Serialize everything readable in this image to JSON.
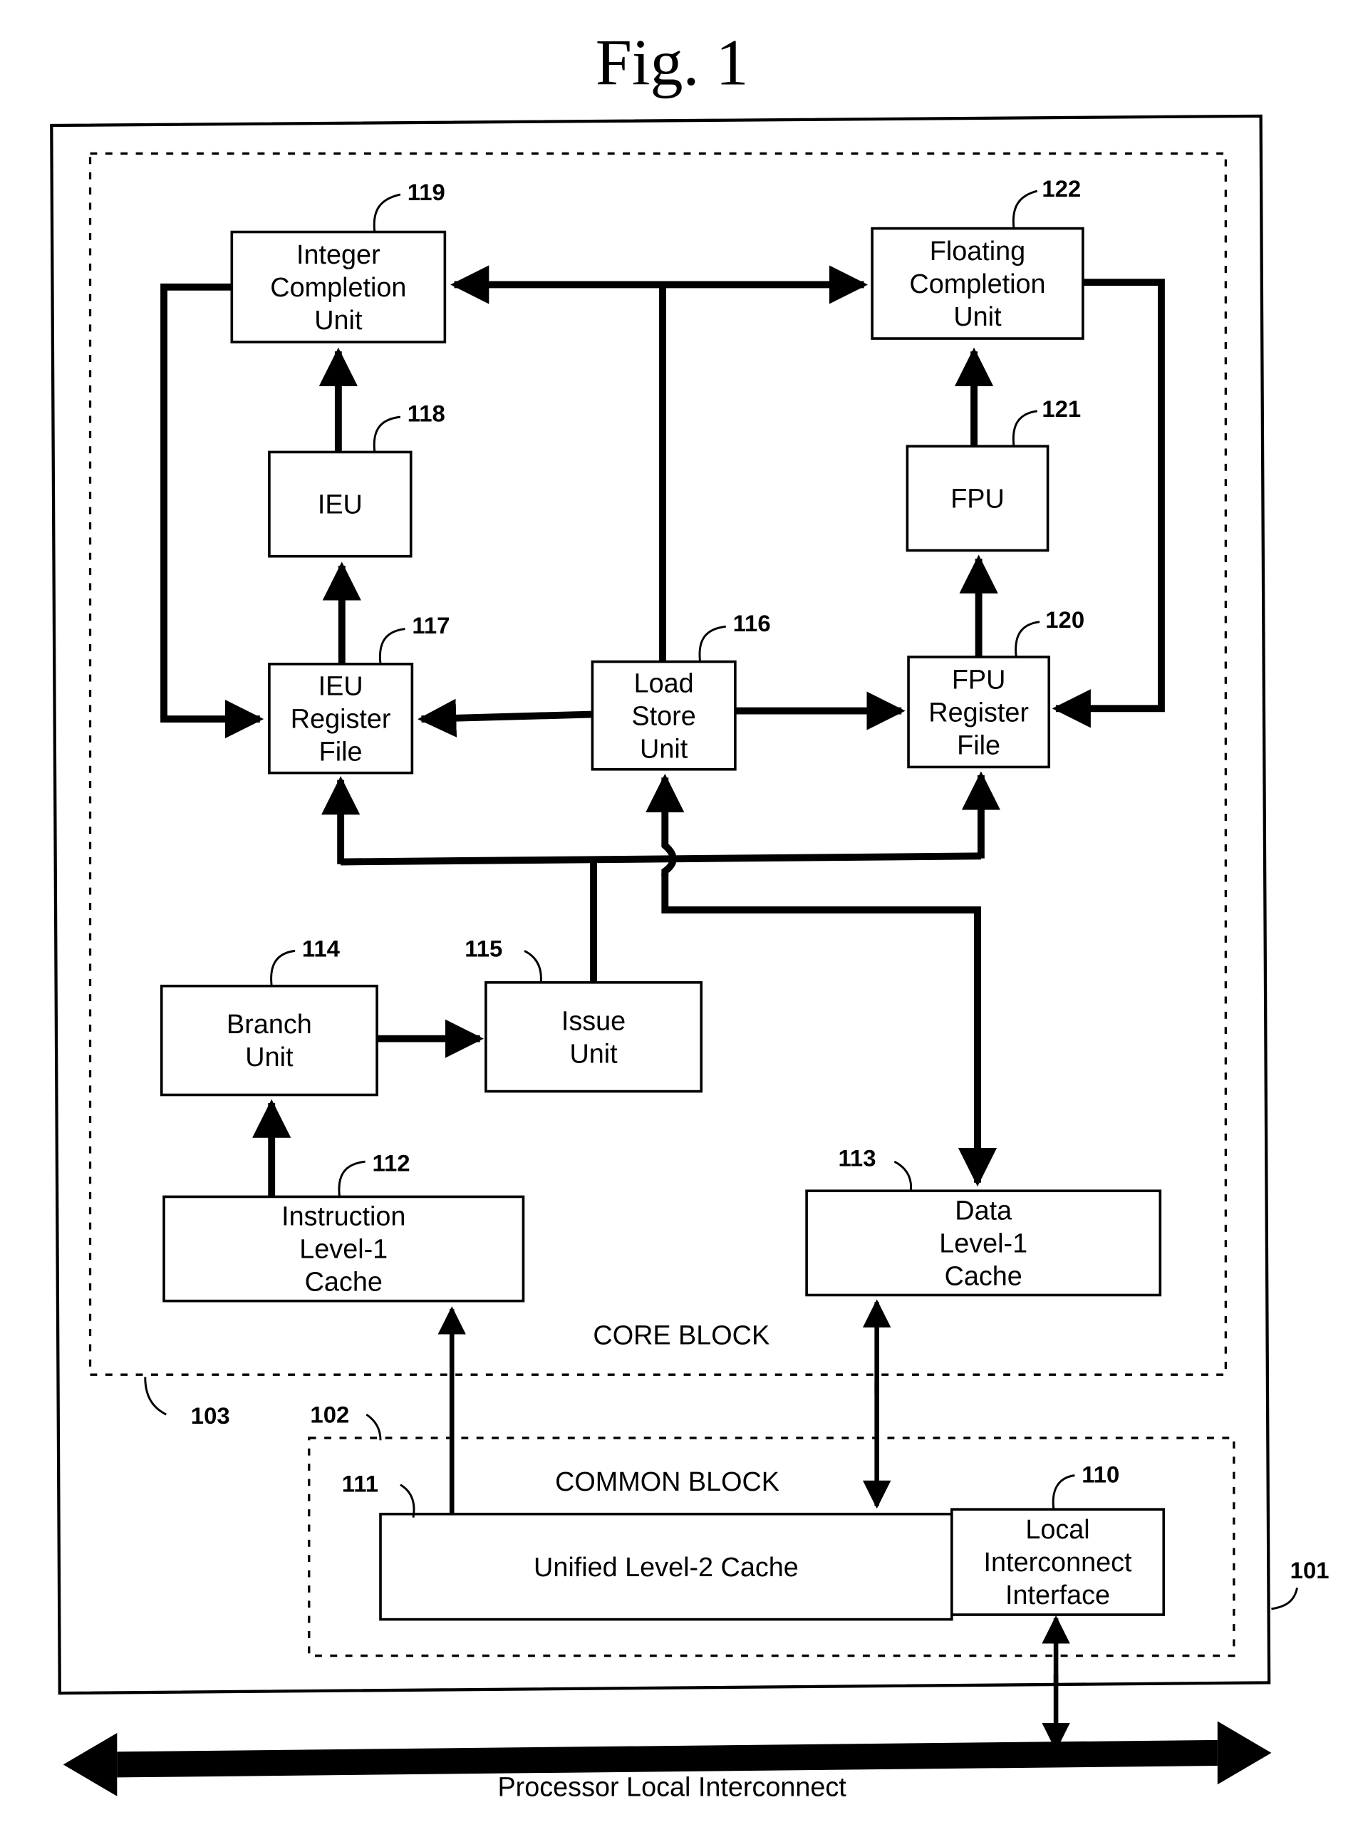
{
  "figure": {
    "title": "Fig. 1",
    "core_block_label": "CORE BLOCK",
    "common_block_label": "COMMON BLOCK",
    "bus_label": "Processor Local Interconnect",
    "refs": {
      "processor": "101",
      "common_block": "102",
      "core_block": "103",
      "local_interconnect_interface": "110",
      "unified_l2_cache": "111",
      "instruction_l1_cache": "112",
      "data_l1_cache": "113",
      "branch_unit": "114",
      "issue_unit": "115",
      "load_store_unit": "116",
      "ieu_register_file": "117",
      "ieu": "118",
      "integer_completion_unit": "119",
      "fpu_register_file": "120",
      "fpu": "121",
      "floating_completion_unit": "122"
    },
    "blocks": {
      "integer_completion_unit": [
        "Integer",
        "Completion",
        "Unit"
      ],
      "floating_completion_unit": [
        "Floating",
        "Completion",
        "Unit"
      ],
      "ieu": [
        "IEU"
      ],
      "fpu": [
        "FPU"
      ],
      "ieu_register_file": [
        "IEU",
        "Register",
        "File"
      ],
      "load_store_unit": [
        "Load",
        "Store",
        "Unit"
      ],
      "fpu_register_file": [
        "FPU",
        "Register",
        "File"
      ],
      "branch_unit": [
        "Branch",
        "Unit"
      ],
      "issue_unit": [
        "Issue",
        "Unit"
      ],
      "instruction_l1_cache": [
        "Instruction",
        "Level-1",
        "Cache"
      ],
      "data_l1_cache": [
        "Data",
        "Level-1",
        "Cache"
      ],
      "unified_l2_cache": [
        "Unified Level-2 Cache"
      ],
      "local_interconnect_interface": [
        "Local",
        "Interconnect",
        "Interface"
      ]
    }
  }
}
